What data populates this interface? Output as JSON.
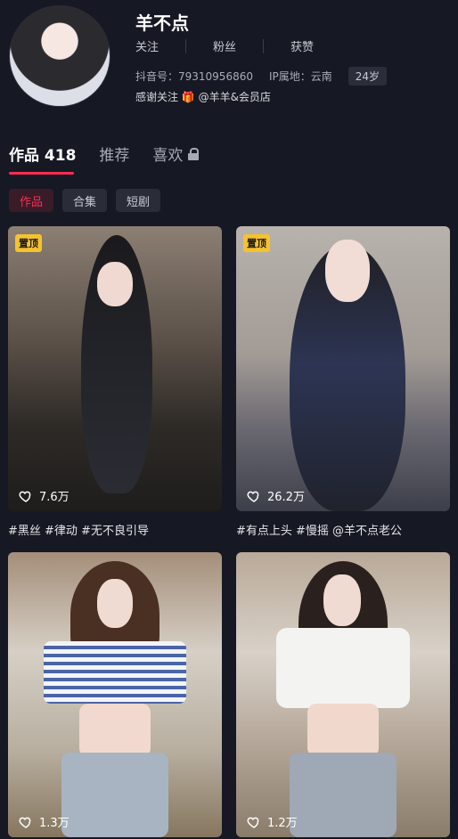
{
  "profile": {
    "name": "羊不点",
    "stats": [
      "关注",
      "粉丝",
      "获赞"
    ],
    "douyin_id": "抖音号：79310956860",
    "ip": "IP属地：云南",
    "age": "24岁",
    "thanks": "感谢关注 🎁 @羊羊&会员店"
  },
  "tabs": [
    {
      "label": "作品 418"
    },
    {
      "label": "推荐"
    },
    {
      "label": "喜欢"
    }
  ],
  "chips": [
    "作品",
    "合集",
    "短剧"
  ],
  "videos": [
    {
      "pinned": "置顶",
      "likes": "7.6万",
      "caption": "#黑丝 #律动 #无不良引导"
    },
    {
      "pinned": "置顶",
      "likes": "26.2万",
      "caption": "#有点上头 #慢摇 @羊不点老公"
    },
    {
      "likes": "1.3万"
    },
    {
      "likes": "1.2万"
    }
  ],
  "colors": {
    "accent": "#fe2c55",
    "background": "#161823",
    "pin": "#f6c22e"
  },
  "icons": {
    "heart": "heart-icon",
    "lock": "lock-icon",
    "gift": "gift-icon"
  }
}
